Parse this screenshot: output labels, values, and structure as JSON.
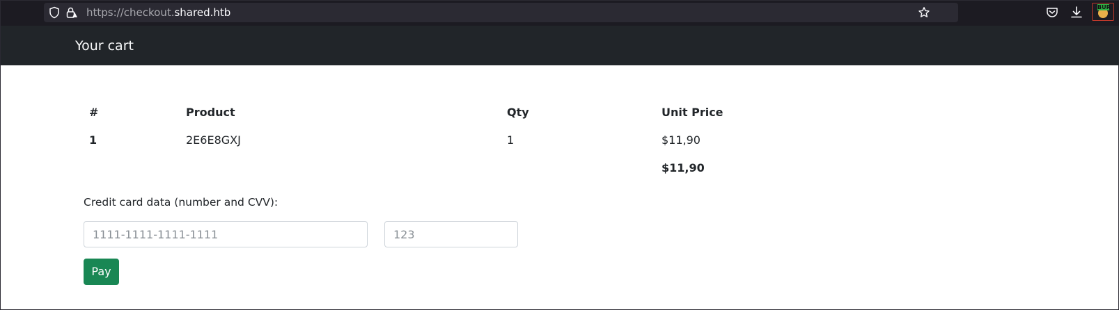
{
  "browser": {
    "url_scheme": "https://checkout.",
    "url_host": "shared.htb",
    "extension_badge": "BUR"
  },
  "navbar": {
    "title": "Your cart"
  },
  "cart": {
    "headers": [
      "#",
      "Product",
      "Qty",
      "Unit Price"
    ],
    "rows": [
      {
        "index": "1",
        "product": "2E6E8GXJ",
        "qty": "1",
        "unit_price": "$11,90"
      }
    ],
    "total": "$11,90"
  },
  "payment": {
    "label": "Credit card data (number and CVV):",
    "card_placeholder": "1111-1111-1111-1111",
    "cvv_placeholder": "123",
    "pay_label": "Pay"
  },
  "colors": {
    "navbar_bg": "#212529",
    "pay_button": "#198754",
    "browser_bg": "#1c1b22"
  }
}
